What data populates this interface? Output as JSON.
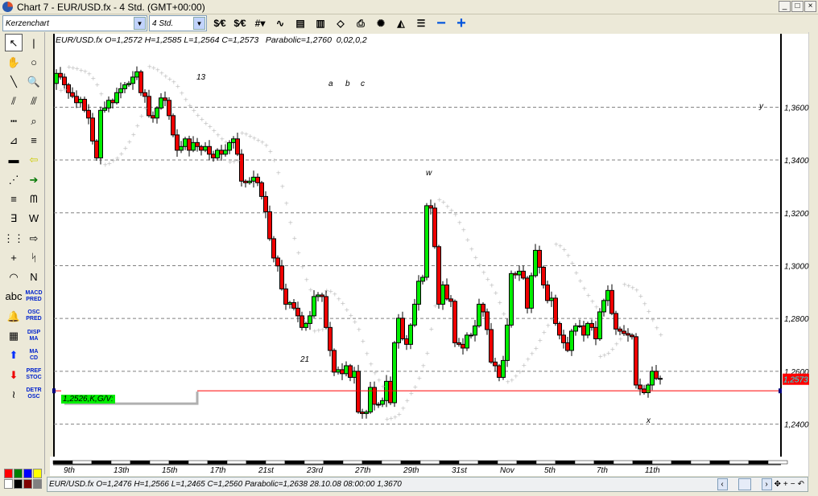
{
  "window": {
    "title": "Chart 7 - EUR/USD.fx - 4 Std. (GMT+00:00)",
    "min": "_",
    "max": "□",
    "close": "×"
  },
  "toolbar": {
    "chart_type": "Kerzenchart",
    "timeframe": "4 Std.",
    "buttons": [
      {
        "name": "currency-dollar-euro-icon",
        "glyph": "$⁄€"
      },
      {
        "name": "currency-dollar-euro-2-icon",
        "glyph": "$⁄€"
      },
      {
        "name": "grid-icon",
        "glyph": "#▾"
      },
      {
        "name": "indicator-icon",
        "glyph": "∿"
      },
      {
        "name": "indicator-panel-icon",
        "glyph": "▤"
      },
      {
        "name": "chart-window-icon",
        "glyph": "▥"
      },
      {
        "name": "open-book-icon",
        "glyph": "◇"
      },
      {
        "name": "print-icon",
        "glyph": "⎙"
      },
      {
        "name": "expert-icon",
        "glyph": "✺"
      },
      {
        "name": "alert-indicator-icon",
        "glyph": "◭"
      },
      {
        "name": "list-indicator-icon",
        "glyph": "☰"
      },
      {
        "name": "zoom-out-icon",
        "glyph": "−"
      },
      {
        "name": "zoom-in-icon",
        "glyph": "+"
      }
    ]
  },
  "tools": [
    {
      "name": "pointer-tool",
      "glyph": "↖"
    },
    {
      "name": "vertical-line-tool",
      "glyph": "|"
    },
    {
      "name": "hand-tool",
      "glyph": "✋"
    },
    {
      "name": "circle-tool",
      "glyph": "○"
    },
    {
      "name": "trend-line-tool",
      "glyph": "╲"
    },
    {
      "name": "magnifier-tool",
      "glyph": "🔍"
    },
    {
      "name": "parallel-lines-tool",
      "glyph": "⫽"
    },
    {
      "name": "fibonacci-tool",
      "glyph": "⫻"
    },
    {
      "name": "horizontal-dotted-lines-tool",
      "glyph": "┅"
    },
    {
      "name": "zoom-window-tool",
      "glyph": "⌕"
    },
    {
      "name": "fan-lines-tool",
      "glyph": "⊿"
    },
    {
      "name": "horizontal-lines-tool",
      "glyph": "≡"
    },
    {
      "name": "rectangle-tool",
      "glyph": "▬"
    },
    {
      "name": "yellow-arrow-left-tool",
      "glyph": "⇦"
    },
    {
      "name": "speed-lines-tool",
      "glyph": "⋰"
    },
    {
      "name": "green-arrow-right-tool",
      "glyph": "➔"
    },
    {
      "name": "color-lines-tool",
      "glyph": "≡"
    },
    {
      "name": "wave-tool",
      "glyph": "ᗰ"
    },
    {
      "name": "color-bracket-tool",
      "glyph": "∃"
    },
    {
      "name": "w-pattern-tool",
      "glyph": "W"
    },
    {
      "name": "dotted-grid-tool",
      "glyph": "⋮⋮"
    },
    {
      "name": "export-tool",
      "glyph": "⇨"
    },
    {
      "name": "crosshair-tool",
      "glyph": "+"
    },
    {
      "name": "zigzag-tool",
      "glyph": "ᛋ"
    },
    {
      "name": "arcs-tool",
      "glyph": "◠"
    },
    {
      "name": "n-pattern-tool",
      "glyph": "N"
    },
    {
      "name": "text-tool",
      "glyph": "abc"
    },
    {
      "name": "macd-pred-tool",
      "glyph": "MACD PRED"
    },
    {
      "name": "bell-tool",
      "glyph": "🔔"
    },
    {
      "name": "osc-pred-tool",
      "glyph": "OSC PRED"
    },
    {
      "name": "calculator-tool",
      "glyph": "▦"
    },
    {
      "name": "disp-ma-tool",
      "glyph": "DISP MA"
    },
    {
      "name": "blue-up-arrow-tool",
      "glyph": "⬆"
    },
    {
      "name": "ma-cd-tool",
      "glyph": "MA CD"
    },
    {
      "name": "red-down-arrow-tool",
      "glyph": "⬇"
    },
    {
      "name": "pref-stoc-tool",
      "glyph": "PREF STOC"
    },
    {
      "name": "squiggle-tool",
      "glyph": "≀"
    },
    {
      "name": "detr-osc-tool",
      "glyph": "DETR OSC"
    }
  ],
  "palette": [
    "#ff0000",
    "#008000",
    "#0000ff",
    "#ffff00",
    "#ffffff",
    "#000000",
    "#800000",
    "#808080"
  ],
  "header": "EUR/USD.fx O=1,2572 H=1,2585 L=1,2564 C=1,2573   Parabolic=1,2760  0,02,0,2",
  "status": {
    "text": "EUR/USD.fx O=1,2476 H=1,2566 L=1,2465 C=1,2560  Parabolic=1,2638  28.10.08 08:00:00 1,3670",
    "prev": "‹",
    "next": "›",
    "move": "✥",
    "plus": "+",
    "minus": "−",
    "undo": "↶"
  },
  "annotations": {
    "n13": "13",
    "a": "a",
    "b": "b",
    "c": "c",
    "w": "w",
    "y": "y",
    "n21": "21",
    "x": "x"
  },
  "hline": {
    "label": "1,2526,K,G/V:",
    "price": 1.2526,
    "color": "#ff0000"
  },
  "chart_data": {
    "type": "candlestick",
    "symbol": "EUR/USD.fx",
    "timeframe": "4 Std.",
    "ylim": [
      1.228,
      1.3875
    ],
    "yticks": [
      1.36,
      1.34,
      1.32,
      1.3,
      1.28,
      1.26,
      1.24
    ],
    "ytick_labels": [
      "1,3600",
      "1,3400",
      "1,3200",
      "1,3000",
      "1,2800",
      "1,2600",
      "1,2400"
    ],
    "last_price": 1.2573,
    "last_price_label": "1,2573",
    "first_open": 1.369,
    "xlabels": [
      {
        "label": "9th",
        "index": 3.6
      },
      {
        "label": "13th",
        "index": 16
      },
      {
        "label": "15th",
        "index": 28
      },
      {
        "label": "17th",
        "index": 40
      },
      {
        "label": "21st",
        "index": 52
      },
      {
        "label": "23rd",
        "index": 64
      },
      {
        "label": "27th",
        "index": 76
      },
      {
        "label": "29th",
        "index": 88
      },
      {
        "label": "31st",
        "index": 100
      },
      {
        "label": "Nov",
        "index": 112
      },
      {
        "label": "5th",
        "index": 123
      },
      {
        "label": "7th",
        "index": 136
      },
      {
        "label": "11th",
        "index": 148
      }
    ],
    "parabolic": {
      "step": 0.02,
      "max": 0.2
    },
    "colors": {
      "up": "#00ee00",
      "down": "#ee0000",
      "sar": "#bbbbbb",
      "grid": "#808080"
    },
    "closes": [
      1.3728,
      1.3714,
      1.3685,
      1.3655,
      1.3641,
      1.3617,
      1.363,
      1.3588,
      1.3559,
      1.3472,
      1.3408,
      1.3588,
      1.3597,
      1.3626,
      1.3617,
      1.3655,
      1.367,
      1.3685,
      1.369,
      1.3714,
      1.3734,
      1.3655,
      1.3641,
      1.3568,
      1.3559,
      1.3597,
      1.3635,
      1.3626,
      1.3568,
      1.3495,
      1.3437,
      1.3451,
      1.348,
      1.3437,
      1.3466,
      1.3451,
      1.3437,
      1.3451,
      1.3422,
      1.3408,
      1.3437,
      1.3422,
      1.3437,
      1.3466,
      1.348,
      1.3422,
      1.332,
      1.3314,
      1.332,
      1.3335,
      1.3314,
      1.3262,
      1.3204,
      1.3102,
      1.3029,
      1.2999,
      1.2912,
      1.2854,
      1.286,
      1.2839,
      1.281,
      1.2766,
      1.2781,
      1.281,
      1.2883,
      1.2889,
      1.2883,
      1.2766,
      1.2679,
      1.2597,
      1.2606,
      1.2591,
      1.2621,
      1.2577,
      1.26,
      1.2446,
      1.244,
      1.2446,
      1.2539,
      1.2475,
      1.2475,
      1.2489,
      1.2562,
      1.2481,
      1.2708,
      1.2801,
      1.2723,
      1.2702,
      1.2775,
      1.2854,
      1.2941,
      1.2956,
      1.3227,
      1.3218,
      1.3072,
      1.2854,
      1.2927,
      1.2874,
      1.2865,
      1.2708,
      1.2702,
      1.2688,
      1.2737,
      1.2737,
      1.2772,
      1.2854,
      1.2825,
      1.2758,
      1.2635,
      1.2621,
      1.2577,
      1.2641,
      1.2775,
      1.297,
      1.2965,
      1.2979,
      1.2953,
      1.2839,
      1.2962,
      1.3058,
      1.2994,
      1.2927,
      1.2868,
      1.2877,
      1.2781,
      1.2737,
      1.2708,
      1.2679,
      1.2752,
      1.2772,
      1.2772,
      1.2737,
      1.2781,
      1.2766,
      1.2723,
      1.2825,
      1.2868,
      1.2906,
      1.2819,
      1.276,
      1.2752,
      1.2743,
      1.2737,
      1.2731,
      1.2548,
      1.2533,
      1.2519,
      1.2548,
      1.26,
      1.2573,
      1.2573
    ]
  }
}
